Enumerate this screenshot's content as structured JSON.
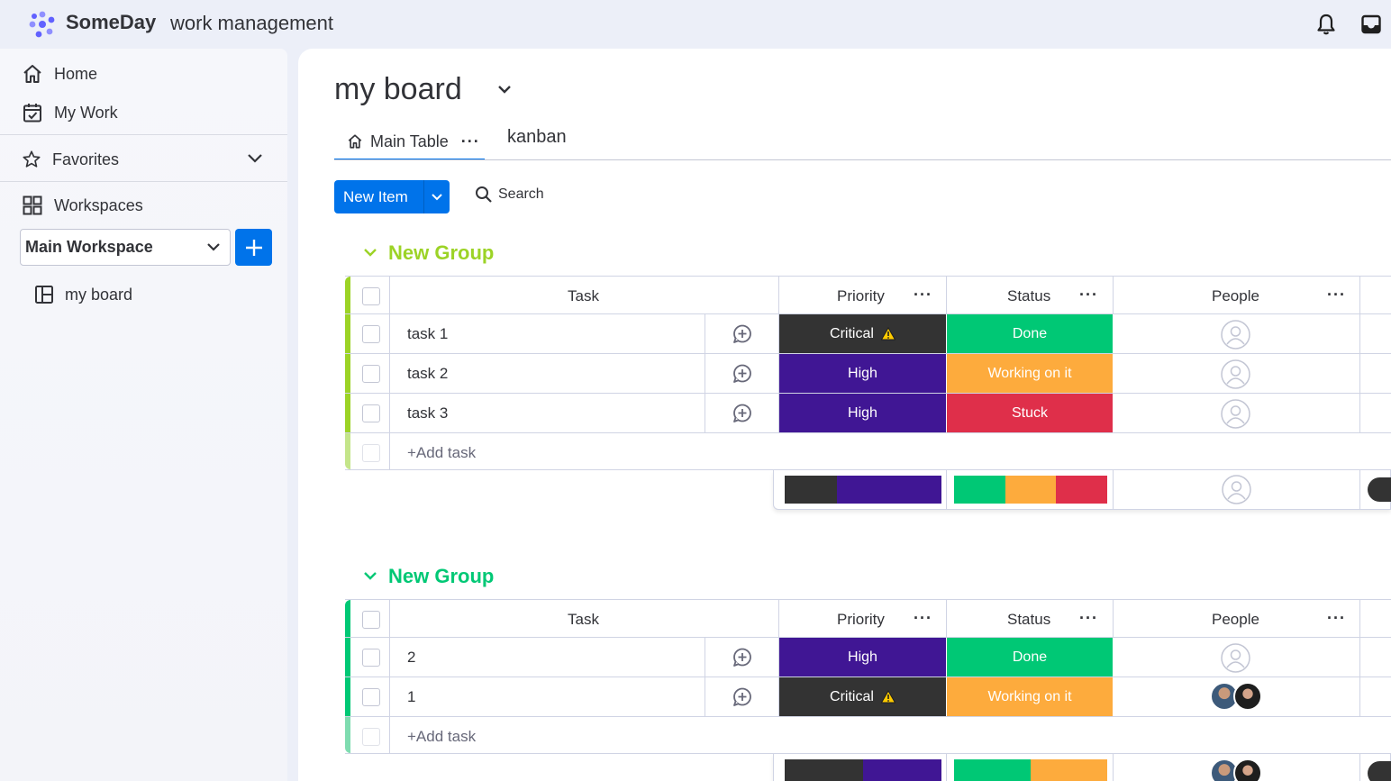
{
  "app": {
    "brand": "SomeDay",
    "brand_sub": "work management"
  },
  "topbar": {
    "icons": [
      "bell-icon",
      "inbox-icon"
    ]
  },
  "sidebar": {
    "home": "Home",
    "my_work": "My Work",
    "favorites": "Favorites",
    "workspaces": "Workspaces",
    "workspace_selected": "Main Workspace",
    "boards": [
      "my board"
    ]
  },
  "board": {
    "title": "my board",
    "tabs": [
      {
        "label": "Main Table"
      },
      {
        "label": "kanban"
      }
    ],
    "new_item": "New Item",
    "search": "Search"
  },
  "columns": {
    "task": "Task",
    "priority": "Priority",
    "status": "Status",
    "people": "People"
  },
  "groups": [
    {
      "name": "New Group",
      "color": "#9cd326",
      "tasks": [
        {
          "name": "task 1",
          "priority": "Critical",
          "status": "Done"
        },
        {
          "name": "task 2",
          "priority": "High",
          "status": "Working on it"
        },
        {
          "name": "task 3",
          "priority": "High",
          "status": "Stuck"
        }
      ],
      "add_task": "+Add task"
    },
    {
      "name": "New Group",
      "color": "#00c875",
      "tasks": [
        {
          "name": "2",
          "priority": "High",
          "status": "Done"
        },
        {
          "name": "1",
          "priority": "Critical",
          "status": "Working on it"
        }
      ],
      "add_task": "+Add task"
    }
  ],
  "colors": {
    "accent": "#0073ea",
    "critical": "#333333",
    "high": "#401694",
    "done": "#00c875",
    "working": "#fdab3d",
    "stuck": "#df2f4a"
  }
}
